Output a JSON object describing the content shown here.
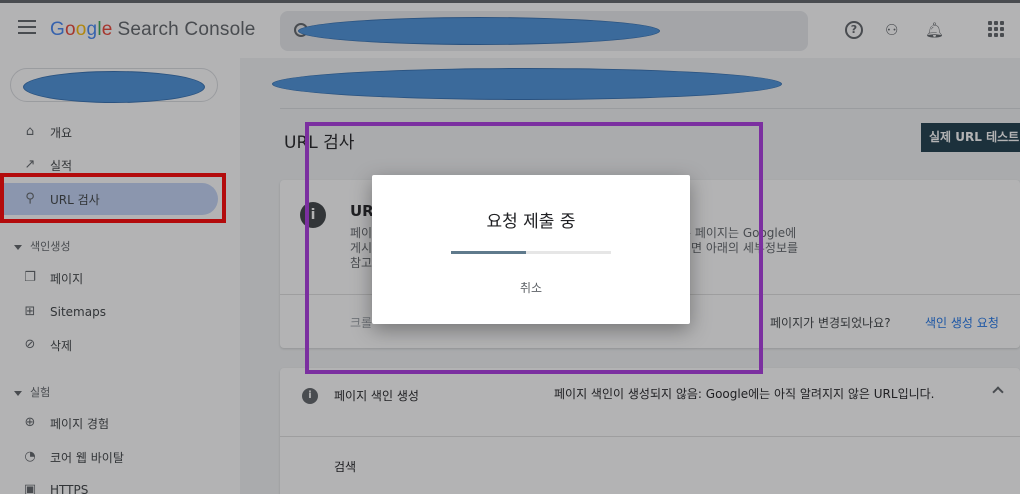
{
  "app": {
    "logo_letters": [
      "G",
      "o",
      "o",
      "g",
      "l",
      "e"
    ],
    "logo_rest": "Search Console"
  },
  "topbar": {
    "icons": [
      "menu-icon",
      "help-icon",
      "admin-icon",
      "bell-icon",
      "apps-icon"
    ]
  },
  "sidebar": {
    "items": [
      {
        "label": "개요",
        "icon": "home-icon"
      },
      {
        "label": "실적",
        "icon": "trending-up-icon"
      },
      {
        "label": "URL 검사",
        "icon": "search-icon",
        "active": true
      }
    ],
    "index_section": {
      "title": "색인생성",
      "items": [
        {
          "label": "페이지",
          "icon": "pages-icon"
        },
        {
          "label": "Sitemaps",
          "icon": "sitemap-icon"
        },
        {
          "label": "삭제",
          "icon": "hidden-icon"
        }
      ]
    },
    "experience_section": {
      "title": "실험",
      "items": [
        {
          "label": "페이지 경험",
          "icon": "add-circle-icon"
        },
        {
          "label": "코어 웹 바이탈",
          "icon": "speed-icon"
        },
        {
          "label": "HTTPS",
          "icon": "lock-icon"
        }
      ]
    }
  },
  "main": {
    "title": "URL 검사",
    "live_test_button": "실제 URL 테스트",
    "card1": {
      "title_fragment": "UR",
      "desc_left": [
        "페이",
        "게시",
        "참고"
      ],
      "desc_right": [
        "은 페이지는 Google에",
        "려면 아래의 세부정보를"
      ],
      "crawl_fragment": "크롤",
      "changed_text": "페이지가 변경되었나요?",
      "request_text": "색인 생성 요청"
    },
    "card2": {
      "title": "페이지 색인 생성",
      "status": "페이지 색인이 생성되지 않음: Google에는 아직 알려지지 않은 URL입니다.",
      "search_label": "검색"
    }
  },
  "dialog": {
    "title": "요청 제출 중",
    "cancel": "취소",
    "progress_percent": 47
  },
  "colors": {
    "scrim": "#202124",
    "annotation_red": "#ff0000",
    "annotation_purple": "#7b2fa0",
    "redaction_blue": "#4a90d9",
    "active_nav": "#c2d4f6"
  }
}
